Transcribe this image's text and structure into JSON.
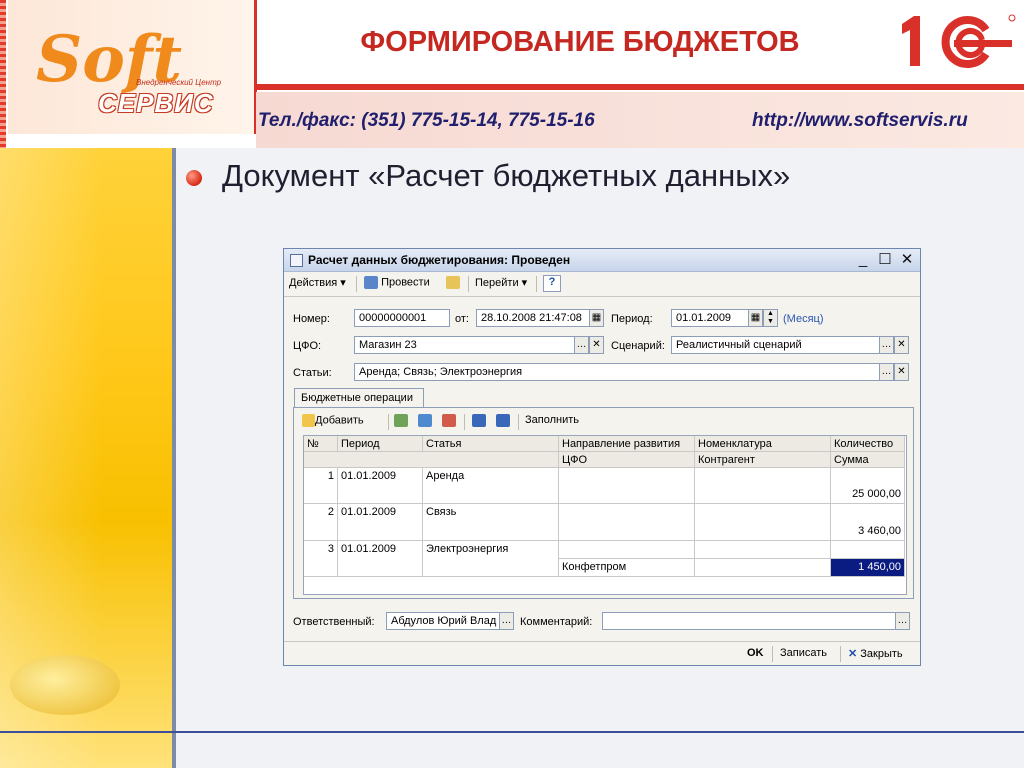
{
  "slide": {
    "title": "ФОРМИРОВАНИЕ БЮДЖЕТОВ",
    "logo": {
      "main": "Soft",
      "sub": "СЕРВИС",
      "tag": "Внедренческий Центр",
      "brand": "1С"
    },
    "contact_phone": "Тел./факс: (351) 775-15-14, 775-15-16",
    "contact_url": "http://www.softservis.ru",
    "heading": "Документ «Расчет бюджетных данных»",
    "colors": {
      "accent": "#d9302a",
      "text_blue": "#1f1f6e",
      "yellow": "#ffc81a"
    }
  },
  "window": {
    "title": "Расчет данных бюджетирования: Проведен",
    "controls": {
      "minimize": "_",
      "maximize": "☐",
      "close": "✕"
    },
    "toolbar": {
      "actions": "Действия",
      "post": "Провести",
      "goto": "Перейти",
      "help": "?"
    },
    "form": {
      "number_label": "Номер:",
      "number_value": "00000000001",
      "from_label": "от:",
      "date_value": "28.10.2008 21:47:08",
      "period_label": "Период:",
      "period_value": "01.01.2009",
      "period_unit": "(Месяц)",
      "cfo_label": "ЦФО:",
      "cfo_value": "Магазин 23",
      "scenario_label": "Сценарий:",
      "scenario_value": "Реалистичный сценарий",
      "articles_label": "Статьи:",
      "articles_value": "Аренда; Связь; Электроэнергия"
    },
    "tab": {
      "label": "Бюджетные операции",
      "add": "Добавить",
      "fill": "Заполнить"
    },
    "table": {
      "headers_top": [
        "№",
        "Период",
        "Статья",
        "Направление развития",
        "Номенклатура",
        "Количество"
      ],
      "headers_bottom": [
        "ЦФО",
        "Контрагент",
        "Сумма"
      ],
      "rows": [
        {
          "n": "1",
          "period": "01.01.2009",
          "article": "Аренда",
          "cfo": "",
          "counterparty": "",
          "amount": "25 000,00"
        },
        {
          "n": "2",
          "period": "01.01.2009",
          "article": "Связь",
          "cfo": "",
          "counterparty": "",
          "amount": "3 460,00"
        },
        {
          "n": "3",
          "period": "01.01.2009",
          "article": "Электроэнергия",
          "cfo": "Конфетпром",
          "counterparty": "",
          "amount": "1 450,00"
        }
      ]
    },
    "bottom": {
      "responsible_label": "Ответственный:",
      "responsible_value": "Абдулов Юрий Влад",
      "comment_label": "Комментарий:",
      "comment_value": ""
    },
    "footer": {
      "ok": "OK",
      "save": "Записать",
      "close": "Закрыть"
    }
  }
}
